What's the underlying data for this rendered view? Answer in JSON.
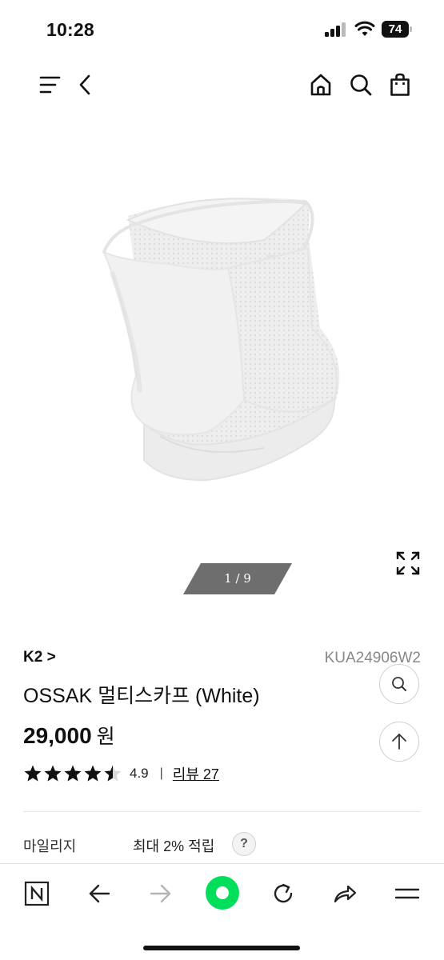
{
  "status_bar": {
    "time": "10:28",
    "battery": "74",
    "icons": [
      "signal-icon",
      "wifi-icon",
      "battery-icon"
    ]
  },
  "top_nav": {
    "icons": [
      "menu-icon",
      "back-icon",
      "home-icon",
      "search-icon",
      "shopping-bag-icon"
    ]
  },
  "gallery": {
    "pager": "1 / 9",
    "icons": [
      "expand-icon"
    ]
  },
  "product": {
    "brand": "K2 >",
    "code": "KUA24906W2",
    "title": "OSSAK 멀티스카프 (White)",
    "price": "29,000",
    "price_unit": "원",
    "rating": "4.9",
    "rating_stars": 4.5,
    "rating_separator": "|",
    "review_link": "리뷰 27"
  },
  "floating_buttons": {
    "icons": [
      "search-icon",
      "arrow-up-icon"
    ]
  },
  "mileage": {
    "label": "마일리지",
    "value": "최대 2% 적립",
    "help": "?"
  },
  "browser_bar": {
    "icons": [
      "naver-n-icon",
      "back-arrow-icon",
      "forward-arrow-icon",
      "green-dot-icon",
      "reload-icon",
      "share-icon",
      "menu-icon"
    ],
    "accent": "#00de5a"
  }
}
